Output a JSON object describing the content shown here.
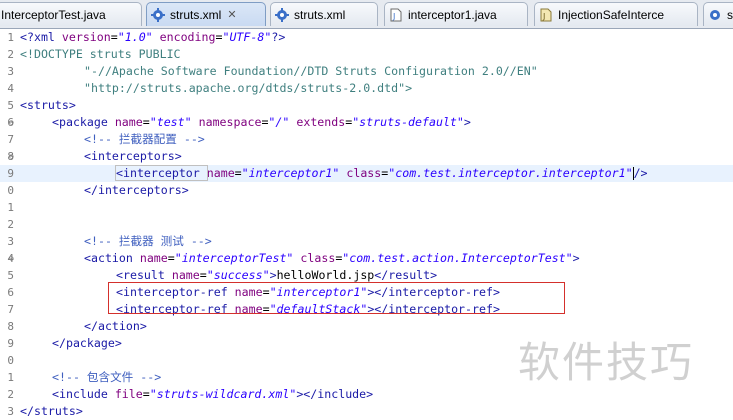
{
  "tabs": [
    {
      "label": "InterceptorTest.java",
      "icon": "java-file-icon",
      "active": false
    },
    {
      "label": "struts.xml",
      "icon": "xml-gear-icon",
      "active": true,
      "close": "✕"
    },
    {
      "label": "struts.xml",
      "icon": "xml-gear-icon",
      "active": false
    },
    {
      "label": "interceptor1.java",
      "icon": "java-file-icon",
      "active": false
    },
    {
      "label": "InjectionSafeInterce",
      "icon": "java-class-icon",
      "active": false
    },
    {
      "label": "s",
      "icon": "xml-gear-icon",
      "active": false
    }
  ],
  "line_numbers": [
    "1",
    "2",
    "3",
    "4",
    "5",
    "6",
    "7",
    "8",
    "9",
    "0",
    "1",
    "2",
    "3",
    "4",
    "5",
    "6",
    "7",
    "8",
    "9",
    "0",
    "1",
    "2",
    "3"
  ],
  "code": {
    "l1": {
      "a": "<?xml ",
      "b": "version",
      "c": "=",
      "d": "\"1.0\"",
      "e": " encoding",
      "f": "=",
      "g": "\"UTF-8\"",
      "h": "?>"
    },
    "l2": "<!DOCTYPE struts PUBLIC",
    "l3": "\"-//Apache Software Foundation//DTD Struts Configuration 2.0//EN\"",
    "l4": "\"http://struts.apache.org/dtds/struts-2.0.dtd\">",
    "l5": "<struts>",
    "l6": {
      "t": "<package ",
      "a1": "name",
      "v1": "\"test\"",
      "a2": " namespace",
      "v2": "\"/\"",
      "a3": " extends",
      "v3": "\"struts-default\"",
      "e": ">"
    },
    "l7": "<!-- 拦截器配置 -->",
    "l8": "<interceptors>",
    "l9": {
      "t": "<interceptor ",
      "a1": "name",
      "v1": "\"interceptor1\"",
      "a2": " class",
      "v2": "\"com.test.interceptor.interceptor1\"",
      "e": "/>"
    },
    "l10": "</interceptors>",
    "l13": "<!-- 拦截器 测试 -->",
    "l14": {
      "t": "<action ",
      "a1": "name",
      "v1": "\"interceptorTest\"",
      "a2": " class",
      "v2": "\"com.test.action.InterceptorTest\"",
      "e": ">"
    },
    "l15": {
      "t": "<result ",
      "a1": "name",
      "v1": "\"success\"",
      "m": ">",
      "txt": "helloWorld.jsp",
      "e": "</result>"
    },
    "l16": {
      "t": "<interceptor-ref ",
      "a1": "name",
      "v1": "\"interceptor1\"",
      "e": "></interceptor-ref>"
    },
    "l17": {
      "t": "<interceptor-ref ",
      "a1": "name",
      "v1": "\"defaultStack\"",
      "e": "></interceptor-ref>"
    },
    "l18": "</action>",
    "l19": "</package>",
    "l21": "<!-- 包含文件 -->",
    "l22": {
      "t": "<include ",
      "a1": "file",
      "v1": "\"struts-wildcard.xml\"",
      "e": "></include>"
    },
    "l23": "</struts>"
  },
  "watermark": "软件技巧",
  "colors": {
    "tag": "#1a1aa6",
    "attr": "#7f007f",
    "value": "#2a00ff",
    "comment": "#3f5fbf",
    "highlight_box": "#d4302c",
    "current_line": "#e8f2fe"
  }
}
